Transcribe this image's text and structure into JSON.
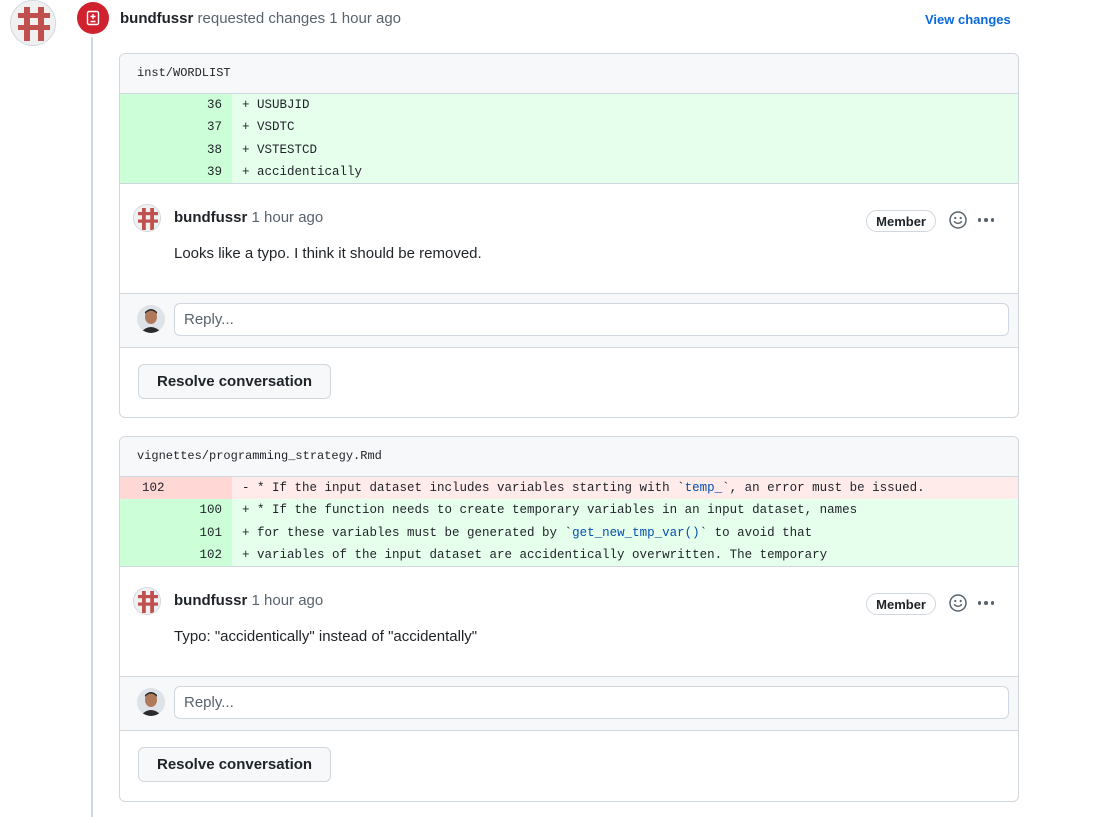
{
  "review": {
    "author": "bundfussr",
    "action": "requested changes",
    "time": "1 hour ago",
    "view_changes_label": "View changes"
  },
  "threads": [
    {
      "file": "inst/WORDLIST",
      "diff": [
        {
          "type": "add",
          "old": "",
          "new": "36",
          "sign": "+",
          "text": "USUBJID"
        },
        {
          "type": "add",
          "old": "",
          "new": "37",
          "sign": "+",
          "text": "VSDTC"
        },
        {
          "type": "add",
          "old": "",
          "new": "38",
          "sign": "+",
          "text": "VSTESTCD"
        },
        {
          "type": "add",
          "old": "",
          "new": "39",
          "sign": "+",
          "text": "accidentically"
        }
      ],
      "comment": {
        "author": "bundfussr",
        "time": "1 hour ago",
        "badge": "Member",
        "body": "Looks like a typo. I think it should be removed."
      },
      "reply_placeholder": "Reply...",
      "resolve_label": "Resolve conversation"
    },
    {
      "file": "vignettes/programming_strategy.Rmd",
      "diff": [
        {
          "type": "del",
          "old": "102",
          "new": "",
          "sign": "-",
          "parts": [
            "* If the input dataset includes variables starting with `",
            "temp_",
            "`, an error must be issued."
          ]
        },
        {
          "type": "add",
          "old": "",
          "new": "100",
          "sign": "+",
          "text": "* If the function needs to create temporary variables in an input dataset, names"
        },
        {
          "type": "add",
          "old": "",
          "new": "101",
          "sign": "+",
          "parts": [
            "for these variables must be generated by `",
            "get_new_tmp_var()",
            "` to avoid that"
          ]
        },
        {
          "type": "add",
          "old": "",
          "new": "102",
          "sign": "+",
          "text": "variables of the input dataset are accidentically overwritten. The temporary"
        }
      ],
      "comment": {
        "author": "bundfussr",
        "time": "1 hour ago",
        "badge": "Member",
        "body": "Typo: \"accidentically\" instead of \"accidentally\""
      },
      "reply_placeholder": "Reply...",
      "resolve_label": "Resolve conversation"
    }
  ],
  "colors": {
    "accent_link": "#0969da",
    "changes_requested": "#cf222e",
    "diff_add_bg": "#e6ffec",
    "diff_del_bg": "#ffebe9"
  },
  "icons": {
    "review_state": "file-diff-icon",
    "emoji": "smiley-icon",
    "menu": "kebab-horizontal-icon"
  }
}
